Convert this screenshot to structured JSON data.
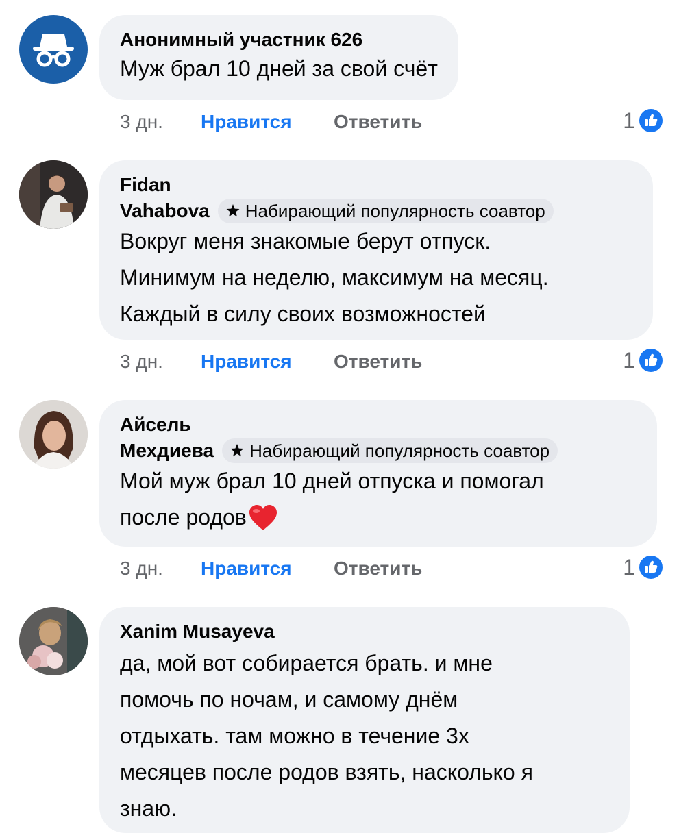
{
  "comments": [
    {
      "author": "Анонимный участник 626",
      "author_line2": "",
      "badge": "",
      "lines": [
        "Муж брал 10 дней за свой счёт"
      ],
      "time": "3 дн.",
      "like_label": "Нравится",
      "reply_label": "Ответить",
      "reactions": "1",
      "avatar_icon": "anonymous-incognito-icon"
    },
    {
      "author": "Fidan",
      "author_line2": "Vahabova",
      "badge": "Набирающий популярность соавтор",
      "lines": [
        "Вокруг меня знакомые берут отпуск.",
        "Минимум на неделю, максимум на месяц.",
        "Каждый в силу своих возможностей"
      ],
      "time": "3 дн.",
      "like_label": "Нравится",
      "reply_label": "Ответить",
      "reactions": "1"
    },
    {
      "author": "Айсель",
      "author_line2": "Мехдиева",
      "badge": "Набирающий популярность соавтор",
      "lines": [
        "Мой муж брал 10 дней отпуска и помогал",
        "после родов"
      ],
      "time": "3 дн.",
      "like_label": "Нравится",
      "reply_label": "Ответить",
      "reactions": "1",
      "emoji": "heart"
    },
    {
      "author": "Xanim Musayeva",
      "author_line2": "",
      "badge": "",
      "lines": [
        "да, мой вот собирается брать. и мне",
        "помочь по ночам, и самому днём",
        "отдыхать. там можно в течение 3х",
        "месяцев после родов взять, насколько я",
        "знаю."
      ]
    }
  ],
  "colors": {
    "bubble": "#f0f2f5",
    "like": "#1877f2",
    "muted": "#65676b",
    "anon_avatar": "#1b5fa8"
  }
}
